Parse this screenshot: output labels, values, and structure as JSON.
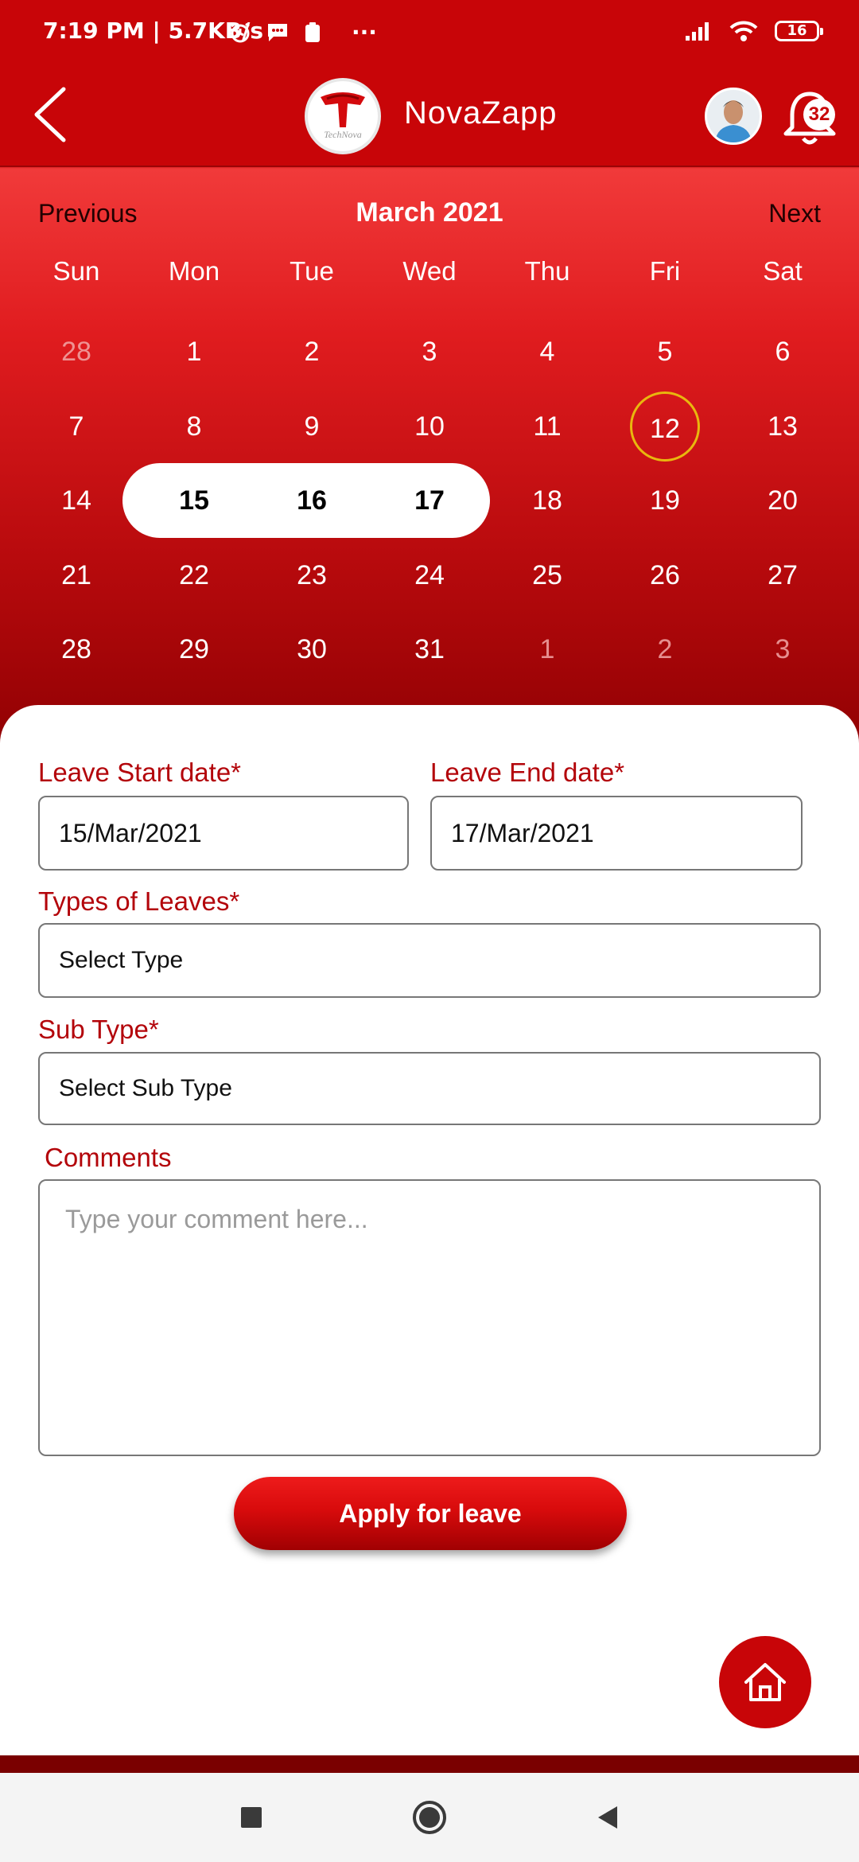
{
  "status_bar": {
    "time_speed": "7:19 PM | 5.7KB/s",
    "more": "···",
    "battery": "16"
  },
  "app_bar": {
    "logo_text": "TechNova",
    "title": "NovaZapp",
    "notification_count": "32"
  },
  "calendar": {
    "prev_label": "Previous",
    "month_title": "March 2021",
    "next_label": "Next",
    "weekdays": [
      "Sun",
      "Mon",
      "Tue",
      "Wed",
      "Thu",
      "Fri",
      "Sat"
    ],
    "weeks": [
      [
        {
          "d": "28",
          "muted": true
        },
        {
          "d": "1"
        },
        {
          "d": "2"
        },
        {
          "d": "3"
        },
        {
          "d": "4"
        },
        {
          "d": "5"
        },
        {
          "d": "6"
        }
      ],
      [
        {
          "d": "7"
        },
        {
          "d": "8"
        },
        {
          "d": "9"
        },
        {
          "d": "10"
        },
        {
          "d": "11"
        },
        {
          "d": "12",
          "today": true
        },
        {
          "d": "13"
        }
      ],
      [
        {
          "d": "14"
        },
        {
          "d": "15",
          "range": true
        },
        {
          "d": "16",
          "range": true
        },
        {
          "d": "17",
          "range": true
        },
        {
          "d": "18"
        },
        {
          "d": "19"
        },
        {
          "d": "20"
        }
      ],
      [
        {
          "d": "21"
        },
        {
          "d": "22"
        },
        {
          "d": "23"
        },
        {
          "d": "24"
        },
        {
          "d": "25"
        },
        {
          "d": "26"
        },
        {
          "d": "27"
        }
      ],
      [
        {
          "d": "28"
        },
        {
          "d": "29"
        },
        {
          "d": "30"
        },
        {
          "d": "31"
        },
        {
          "d": "1",
          "muted": true
        },
        {
          "d": "2",
          "muted": true
        },
        {
          "d": "3",
          "muted": true
        }
      ]
    ]
  },
  "form": {
    "start_label": "Leave Start date*",
    "start_value": "15/Mar/2021",
    "end_label": "Leave End date*",
    "end_value": "17/Mar/2021",
    "type_label": "Types of Leaves*",
    "type_value": "Select Type",
    "subtype_label": "Sub Type*",
    "subtype_value": "Select Sub Type",
    "comments_label": "Comments",
    "comments_placeholder": "Type your comment here...",
    "apply_label": "Apply for leave"
  },
  "colors": {
    "brand_red": "#c80508",
    "label_red": "#b3040a",
    "today_ring": "#e9b70e"
  }
}
